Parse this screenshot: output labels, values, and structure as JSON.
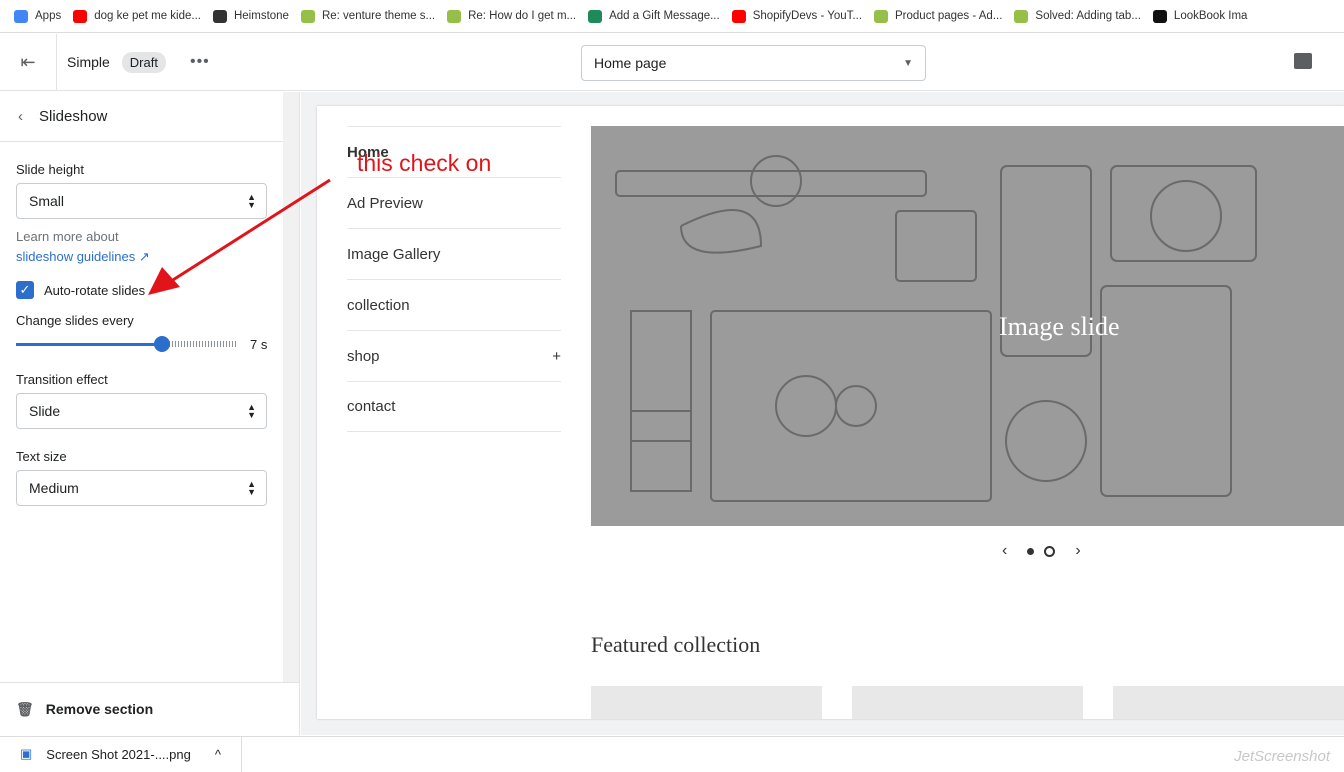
{
  "bookmarks": [
    "Apps",
    "dog ke pet me kide...",
    "Heimstone",
    "Re: venture theme s...",
    "Re: How do I get m...",
    "Add a Gift Message...",
    "ShopifyDevs - YouT...",
    "Product pages - Ad...",
    "Solved: Adding tab...",
    "LookBook Ima"
  ],
  "bookmark_colors": [
    "#4285f4",
    "#ff0000",
    "#333333",
    "#95bf47",
    "#95bf47",
    "#1e8a5a",
    "#ff0000",
    "#95bf47",
    "#95bf47",
    "#111111"
  ],
  "topbar": {
    "theme": "Simple",
    "badge": "Draft",
    "page": "Home page"
  },
  "sidebar": {
    "title": "Slideshow",
    "slide_height_label": "Slide height",
    "slide_height": "Small",
    "help": "Learn more about",
    "help_link": "slideshow guidelines",
    "autorotate": "Auto-rotate slides",
    "autorotate_checked": true,
    "change_label": "Change slides every",
    "change_value": "7 s",
    "change_seconds": 7,
    "transition_label": "Transition effect",
    "transition": "Slide",
    "text_size_label": "Text size",
    "text_size": "Medium",
    "remove": "Remove section"
  },
  "preview": {
    "nav": [
      "Home",
      "Ad Preview",
      "Image Gallery",
      "collection",
      "shop",
      "contact"
    ],
    "shop_expand": "+",
    "hero_text": "Image slide",
    "featured": "Featured collection"
  },
  "annotation": "this check on",
  "download": "Screen Shot 2021-....png",
  "watermark": "JetScreenshot",
  "accent": "#2c6ecb"
}
